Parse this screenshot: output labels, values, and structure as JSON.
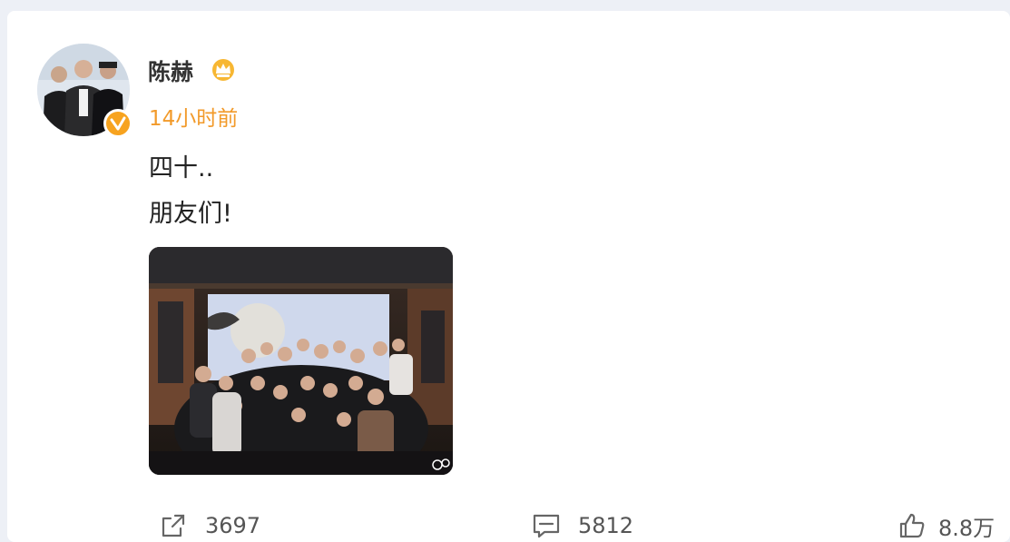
{
  "post": {
    "author": {
      "name": "陈赫",
      "avatar_icon": "avatar-photo",
      "verified_icon": "verified-badge-icon",
      "vip_icon": "crown-icon"
    },
    "timestamp": "14小时前",
    "text_lines": [
      "四十..",
      "朋友们!"
    ],
    "image_icon": "group-party-photo"
  },
  "actions": {
    "repost": {
      "icon": "repost-icon",
      "count": "3697"
    },
    "comment": {
      "icon": "comment-icon",
      "count": "5812"
    },
    "like": {
      "icon": "thumbs-up-icon",
      "count": "8.8万"
    }
  },
  "colors": {
    "accent_orange": "#f29a2a",
    "badge_orange": "#f7a31f",
    "text_dark": "#333333",
    "background": "#edf0f6"
  }
}
